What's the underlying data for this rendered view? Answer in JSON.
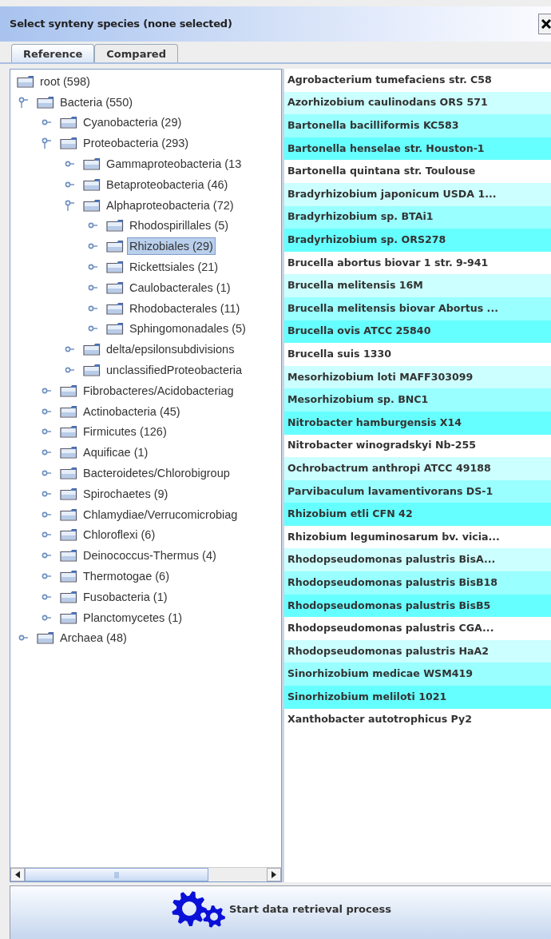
{
  "window": {
    "title": "Select synteny species (none selected)"
  },
  "tabs": [
    {
      "label": "Reference",
      "selected": true
    },
    {
      "label": "Compared",
      "selected": false
    }
  ],
  "tree": {
    "nodes": [
      {
        "label": "root (598)",
        "selected": false,
        "children": [
          {
            "label": "Bacteria (550)",
            "expanded": true,
            "selected": false,
            "children": [
              {
                "label": "Cyanobacteria (29)",
                "expanded": false,
                "selected": false
              },
              {
                "label": "Proteobacteria (293)",
                "expanded": true,
                "selected": false,
                "children": [
                  {
                    "label": "Gammaproteobacteria (13",
                    "expanded": false,
                    "selected": false
                  },
                  {
                    "label": "Betaproteobacteria (46)",
                    "expanded": false,
                    "selected": false
                  },
                  {
                    "label": "Alphaproteobacteria (72)",
                    "expanded": true,
                    "selected": false,
                    "children": [
                      {
                        "label": "Rhodospirillales (5)",
                        "expanded": false,
                        "selected": false
                      },
                      {
                        "label": "Rhizobiales (29)",
                        "expanded": false,
                        "selected": true
                      },
                      {
                        "label": "Rickettsiales (21)",
                        "expanded": false,
                        "selected": false
                      },
                      {
                        "label": "Caulobacterales (1)",
                        "expanded": false,
                        "selected": false
                      },
                      {
                        "label": "Rhodobacterales (11)",
                        "expanded": false,
                        "selected": false
                      },
                      {
                        "label": "Sphingomonadales (5)",
                        "expanded": false,
                        "selected": false
                      }
                    ]
                  },
                  {
                    "label": "delta/epsilonsubdivisions",
                    "expanded": false,
                    "selected": false
                  },
                  {
                    "label": "unclassifiedProteobacteria",
                    "expanded": false,
                    "selected": false
                  }
                ]
              },
              {
                "label": "Fibrobacteres/Acidobacteriag",
                "expanded": false,
                "selected": false
              },
              {
                "label": "Actinobacteria (45)",
                "expanded": false,
                "selected": false
              },
              {
                "label": "Firmicutes (126)",
                "expanded": false,
                "selected": false
              },
              {
                "label": "Aquificae (1)",
                "expanded": false,
                "selected": false
              },
              {
                "label": "Bacteroidetes/Chlorobigroup",
                "expanded": false,
                "selected": false
              },
              {
                "label": "Spirochaetes (9)",
                "expanded": false,
                "selected": false
              },
              {
                "label": "Chlamydiae/Verrucomicrobiag",
                "expanded": false,
                "selected": false
              },
              {
                "label": "Chloroflexi (6)",
                "expanded": false,
                "selected": false
              },
              {
                "label": "Deinococcus-Thermus (4)",
                "expanded": false,
                "selected": false
              },
              {
                "label": "Thermotogae (6)",
                "expanded": false,
                "selected": false
              },
              {
                "label": "Fusobacteria (1)",
                "expanded": false,
                "selected": false
              },
              {
                "label": "Planctomycetes (1)",
                "expanded": false,
                "selected": false
              }
            ]
          },
          {
            "label": "Archaea (48)",
            "expanded": false,
            "selected": false
          }
        ]
      }
    ]
  },
  "species": [
    {
      "name": "Agrobacterium tumefaciens str. C58",
      "color": "#ffffff"
    },
    {
      "name": "Azorhizobium caulinodans ORS 571",
      "color": "#ccffff"
    },
    {
      "name": "Bartonella bacilliformis KC583",
      "color": "#99ffff"
    },
    {
      "name": "Bartonella henselae str. Houston-1",
      "color": "#66ffff"
    },
    {
      "name": "Bartonella quintana str. Toulouse",
      "color": "#ffffff"
    },
    {
      "name": "Bradyrhizobium japonicum USDA 1...",
      "color": "#ccffff"
    },
    {
      "name": "Bradyrhizobium sp. BTAi1",
      "color": "#99ffff"
    },
    {
      "name": "Bradyrhizobium sp. ORS278",
      "color": "#66ffff"
    },
    {
      "name": "Brucella abortus biovar 1 str. 9-941",
      "color": "#ffffff"
    },
    {
      "name": "Brucella melitensis 16M",
      "color": "#ccffff"
    },
    {
      "name": "Brucella melitensis biovar Abortus ...",
      "color": "#99ffff"
    },
    {
      "name": "Brucella ovis ATCC 25840",
      "color": "#66ffff"
    },
    {
      "name": "Brucella suis 1330",
      "color": "#ffffff"
    },
    {
      "name": "Mesorhizobium loti MAFF303099",
      "color": "#ccffff"
    },
    {
      "name": "Mesorhizobium sp. BNC1",
      "color": "#99ffff"
    },
    {
      "name": "Nitrobacter hamburgensis X14",
      "color": "#66ffff"
    },
    {
      "name": "Nitrobacter winogradskyi Nb-255",
      "color": "#ffffff"
    },
    {
      "name": "Ochrobactrum anthropi ATCC 49188",
      "color": "#ccffff"
    },
    {
      "name": "Parvibaculum lavamentivorans DS-1",
      "color": "#99ffff"
    },
    {
      "name": "Rhizobium etli CFN 42",
      "color": "#66ffff"
    },
    {
      "name": "Rhizobium leguminosarum bv. vicia...",
      "color": "#ffffff"
    },
    {
      "name": "Rhodopseudomonas palustris BisA...",
      "color": "#ccffff"
    },
    {
      "name": "Rhodopseudomonas palustris BisB18",
      "color": "#99ffff"
    },
    {
      "name": "Rhodopseudomonas palustris BisB5",
      "color": "#66ffff"
    },
    {
      "name": "Rhodopseudomonas palustris CGA...",
      "color": "#ffffff"
    },
    {
      "name": "Rhodopseudomonas palustris HaA2",
      "color": "#ccffff"
    },
    {
      "name": "Sinorhizobium medicae WSM419",
      "color": "#99ffff"
    },
    {
      "name": "Sinorhizobium meliloti 1021",
      "color": "#66ffff"
    },
    {
      "name": "Xanthobacter autotrophicus Py2",
      "color": "#ffffff"
    }
  ],
  "action_button": {
    "label": "Start data retrieval process"
  }
}
